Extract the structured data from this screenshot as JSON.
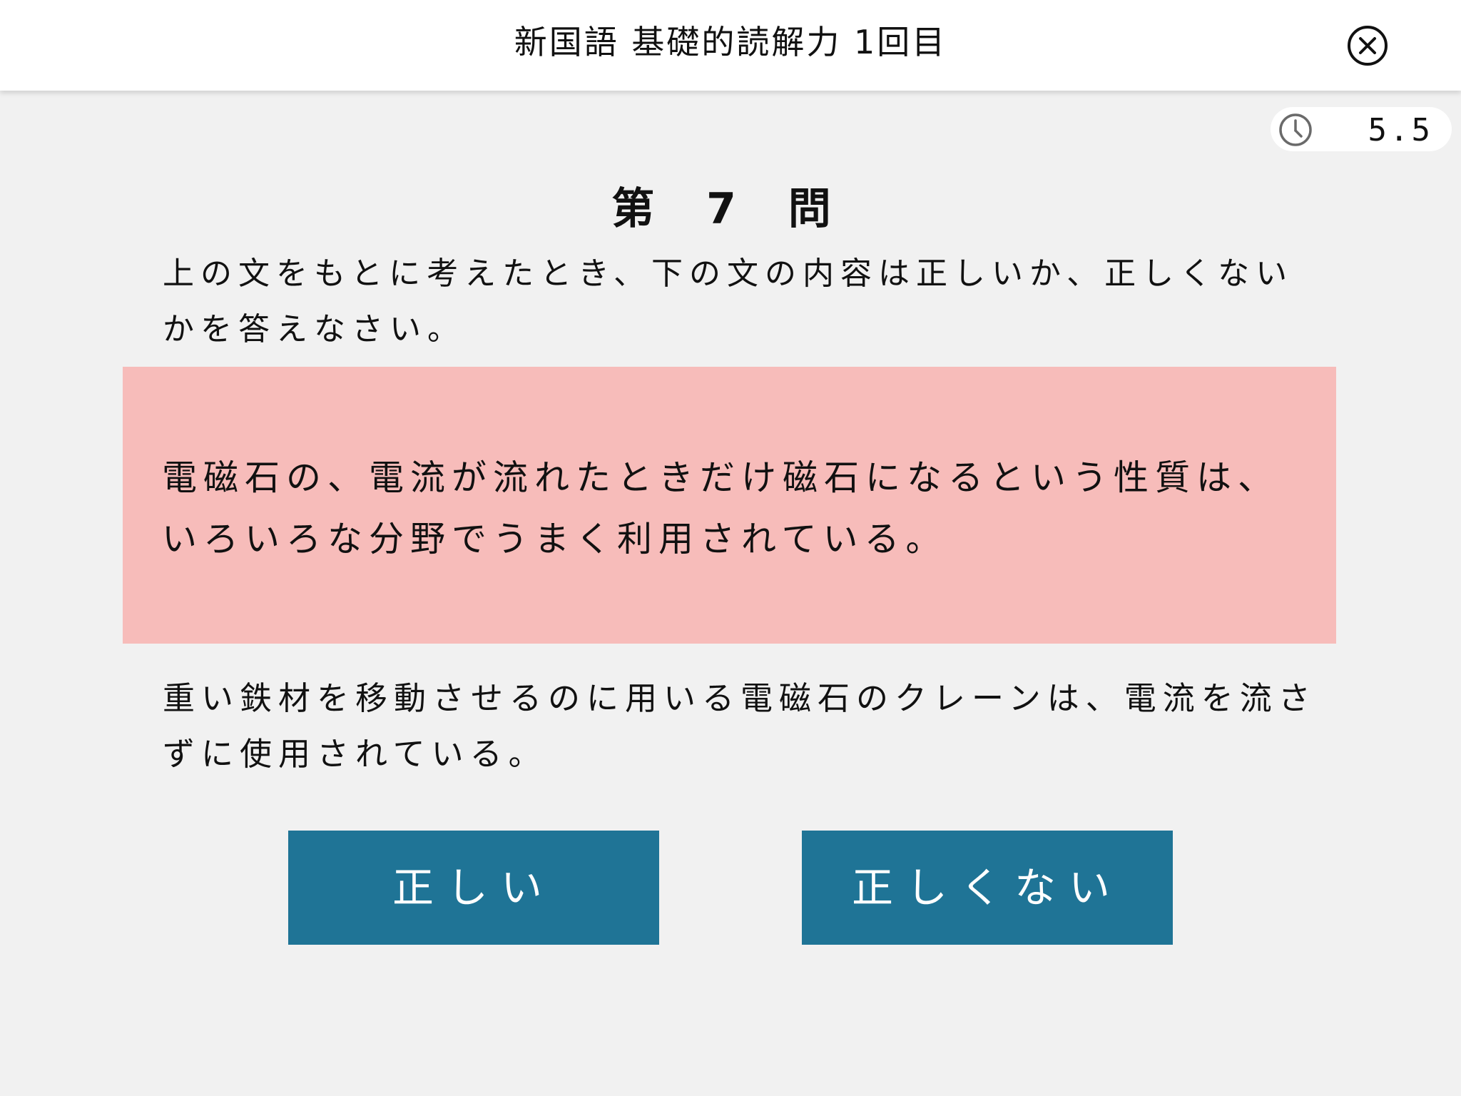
{
  "header": {
    "title": "新国語 基礎的読解力 1回目",
    "close_icon": "close-circle-icon"
  },
  "timer": {
    "icon": "clock-icon",
    "value": "5.5"
  },
  "question": {
    "number_label": "第 7 問",
    "instruction": "上の文をもとに考えたとき、下の文の内容は正しいか、正しくないかを答えなさい。"
  },
  "passage": {
    "text": "電磁石の、電流が流れたときだけ磁石になるという性質は、いろいろな分野でうまく利用されている。",
    "background_color": "#f7bcba"
  },
  "statement": {
    "text": "重い鉄材を移動させるのに用いる電磁石のクレーンは、電流を流さずに使用されている。"
  },
  "answers": {
    "true_label": "正しい",
    "false_label": "正しくない",
    "button_color": "#1f7496"
  }
}
